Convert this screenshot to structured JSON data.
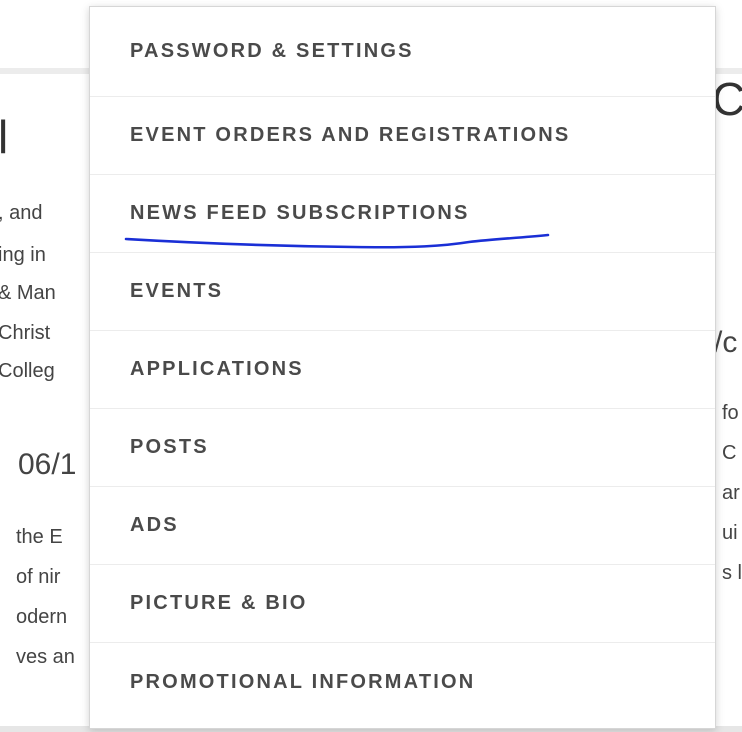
{
  "menu": {
    "items": [
      {
        "label": "PASSWORD & SETTINGS"
      },
      {
        "label": "EVENT ORDERS AND REGISTRATIONS"
      },
      {
        "label": "NEWS FEED SUBSCRIPTIONS"
      },
      {
        "label": "EVENTS"
      },
      {
        "label": "APPLICATIONS"
      },
      {
        "label": "POSTS"
      },
      {
        "label": "ADS"
      },
      {
        "label": "PICTURE & BIO"
      },
      {
        "label": "PROMOTIONAL INFORMATION"
      }
    ]
  },
  "background": {
    "left": {
      "heading": "l",
      "lines": [
        ", and",
        "ing in",
        "& Man",
        "Christ",
        "Colleg"
      ],
      "date": "06/1",
      "lines2": [
        "the E",
        "of nir",
        "odern",
        "ves an"
      ]
    },
    "right": {
      "heading": "C",
      "subheading": "/c",
      "lines": [
        "fo",
        "C",
        "ar",
        "ui",
        "s l"
      ]
    }
  },
  "colors": {
    "menu_text": "#4a4a4a",
    "annotation": "#1a2fd6"
  }
}
